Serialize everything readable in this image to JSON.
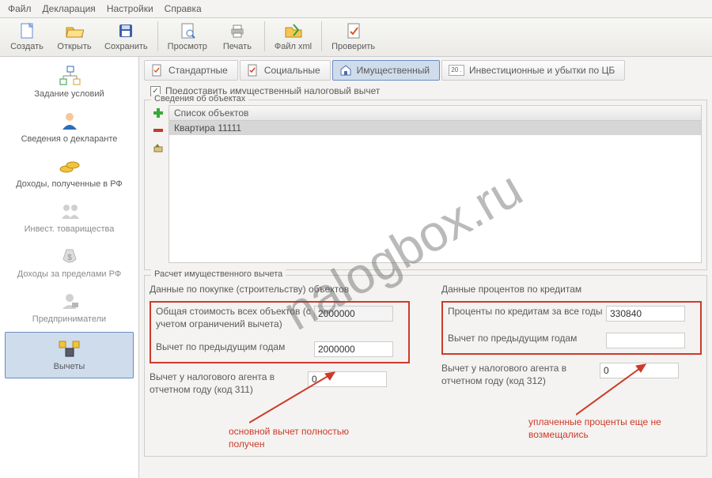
{
  "menubar": [
    "Файл",
    "Декларация",
    "Настройки",
    "Справка"
  ],
  "toolbar": {
    "create": "Создать",
    "open": "Открыть",
    "save": "Сохранить",
    "preview": "Просмотр",
    "print": "Печать",
    "filexml": "Файл xml",
    "check": "Проверить"
  },
  "sidebar": {
    "items": [
      {
        "label": "Задание условий"
      },
      {
        "label": "Сведения о декларанте"
      },
      {
        "label": "Доходы, полученные в РФ"
      },
      {
        "label": "Инвест. товарищества"
      },
      {
        "label": "Доходы за пределами РФ"
      },
      {
        "label": "Предприниматели"
      },
      {
        "label": "Вычеты"
      }
    ]
  },
  "tabs": {
    "standard": "Стандартные",
    "social": "Социальные",
    "property": "Имущественный",
    "invest": "Инвестиционные и убытки по ЦБ",
    "invest_badge": "20 ."
  },
  "checkbox_label": "Предоставить имущественный налоговый вычет",
  "objects": {
    "group_title": "Сведения об объектах",
    "header": "Список объектов",
    "items": [
      "Квартира 11111"
    ]
  },
  "calc": {
    "group_title": "Расчет имущественного вычета",
    "purchase": {
      "title": "Данные по покупке (строительству) объектов",
      "total_cost_label": "Общая стоимость всех объектов (с учетом ограничений вычета)",
      "total_cost_value": "2000000",
      "prev_years_label": "Вычет по предыдущим годам",
      "prev_years_value": "2000000",
      "agent_label": "Вычет у налогового агента в отчетном году (код 311)",
      "agent_value": "0"
    },
    "credits": {
      "title": "Данные процентов по кредитам",
      "interest_label": "Проценты по кредитам за все годы",
      "interest_value": "330840",
      "prev_years_label": "Вычет по предыдущим годам",
      "prev_years_value": "",
      "agent_label": "Вычет у налогового агента в отчетном году (код 312)",
      "agent_value": "0"
    }
  },
  "annotations": {
    "main_done": "основной вычет полностью получен",
    "interest_not": "уплаченные проценты еще не возмещались"
  },
  "watermark": "nalogbox.ru"
}
